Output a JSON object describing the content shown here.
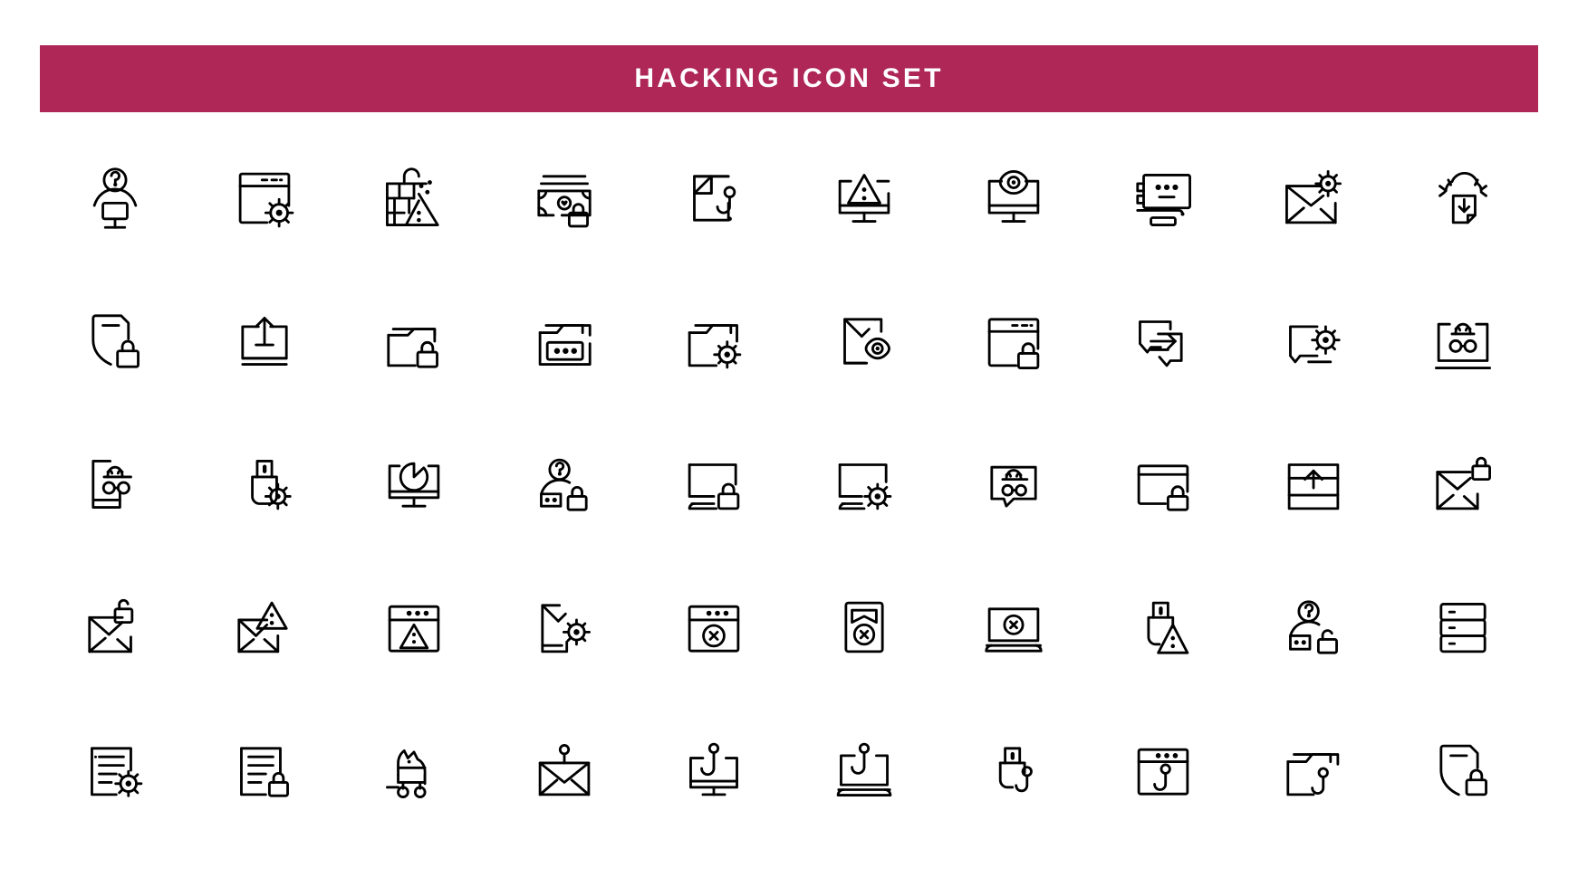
{
  "banner": {
    "title": "HACKING ICON SET",
    "background_color": "#ae2757",
    "text_color": "#ffffff"
  },
  "page": {
    "background_color": "#ffffff",
    "icon_color": "#000000",
    "style": "outline",
    "columns": 10,
    "rows": 5,
    "icon_count": 50
  },
  "icons": [
    {
      "index": 1,
      "name": "anonymous-hacker-monitor-icon"
    },
    {
      "index": 2,
      "name": "browser-window-virus-icon"
    },
    {
      "index": 3,
      "name": "firewall-brick-wall-warning-icon"
    },
    {
      "index": 4,
      "name": "money-banknote-lock-icon"
    },
    {
      "index": 5,
      "name": "document-phishing-hook-icon"
    },
    {
      "index": 6,
      "name": "monitor-warning-alert-icon"
    },
    {
      "index": 7,
      "name": "monitor-spy-eye-icon"
    },
    {
      "index": 8,
      "name": "monitor-password-dots-icon"
    },
    {
      "index": 9,
      "name": "email-envelope-virus-icon"
    },
    {
      "index": 10,
      "name": "cloud-download-virus-icon"
    },
    {
      "index": 11,
      "name": "shield-lock-icon"
    },
    {
      "index": 12,
      "name": "monitor-upload-arrow-icon"
    },
    {
      "index": 13,
      "name": "folder-lock-icon"
    },
    {
      "index": 14,
      "name": "folder-password-icon"
    },
    {
      "index": 15,
      "name": "folder-virus-icon"
    },
    {
      "index": 16,
      "name": "smartphone-spy-eye-icon"
    },
    {
      "index": 17,
      "name": "browser-window-lock-icon"
    },
    {
      "index": 18,
      "name": "chat-bubble-data-transfer-icon"
    },
    {
      "index": 19,
      "name": "chat-bubble-virus-icon"
    },
    {
      "index": 20,
      "name": "laptop-incognito-spy-icon"
    },
    {
      "index": 21,
      "name": "smartphone-incognito-spy-icon"
    },
    {
      "index": 22,
      "name": "usb-drive-virus-icon"
    },
    {
      "index": 23,
      "name": "monitor-malware-pacman-icon"
    },
    {
      "index": 24,
      "name": "anonymous-hacker-lock-icon"
    },
    {
      "index": 25,
      "name": "laptop-lock-icon"
    },
    {
      "index": 26,
      "name": "laptop-virus-icon"
    },
    {
      "index": 27,
      "name": "chat-bubble-incognito-icon"
    },
    {
      "index": 28,
      "name": "browser-window-lock-small-icon"
    },
    {
      "index": 29,
      "name": "browser-window-upload-icon"
    },
    {
      "index": 30,
      "name": "email-envelope-lock-icon"
    },
    {
      "index": 31,
      "name": "email-envelope-unlocked-icon"
    },
    {
      "index": 32,
      "name": "email-envelope-warning-icon"
    },
    {
      "index": 33,
      "name": "browser-window-warning-icon"
    },
    {
      "index": 34,
      "name": "smartphone-virus-icon"
    },
    {
      "index": 35,
      "name": "browser-window-error-icon"
    },
    {
      "index": 36,
      "name": "smartphone-error-icon"
    },
    {
      "index": 37,
      "name": "laptop-error-icon"
    },
    {
      "index": 38,
      "name": "usb-drive-warning-icon"
    },
    {
      "index": 39,
      "name": "anonymous-hacker-unlocked-icon"
    },
    {
      "index": 40,
      "name": "server-rack-icon"
    },
    {
      "index": 41,
      "name": "server-list-virus-icon"
    },
    {
      "index": 42,
      "name": "server-list-lock-icon"
    },
    {
      "index": 43,
      "name": "trojan-horse-icon"
    },
    {
      "index": 44,
      "name": "email-envelope-phishing-hook-icon"
    },
    {
      "index": 45,
      "name": "monitor-phishing-hook-icon"
    },
    {
      "index": 46,
      "name": "laptop-phishing-hook-icon"
    },
    {
      "index": 47,
      "name": "usb-drive-phishing-hook-icon"
    },
    {
      "index": 48,
      "name": "browser-window-phishing-hook-icon"
    },
    {
      "index": 49,
      "name": "folder-phishing-hook-icon"
    },
    {
      "index": 50,
      "name": "shield-lock-outline-icon"
    }
  ]
}
